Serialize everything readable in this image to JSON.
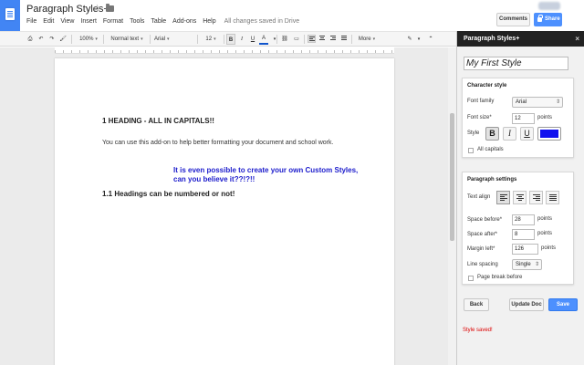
{
  "header": {
    "doc_title": "Paragraph Styles+",
    "menu": [
      "File",
      "Edit",
      "View",
      "Insert",
      "Format",
      "Tools",
      "Table",
      "Add-ons",
      "Help"
    ],
    "save_status": "All changes saved in Drive",
    "comments_label": "Comments",
    "share_label": "Share"
  },
  "toolbar": {
    "zoom": "100%",
    "style": "Normal text",
    "font": "Arial",
    "size": "12",
    "bold": "B",
    "italic": "I",
    "underline": "U",
    "text_color": "A",
    "more": "More"
  },
  "document": {
    "heading1": "1 HEADING - ALL IN CAPITALS!!",
    "paragraph": "You can use this add-on to help better formatting your document and school work.",
    "custom_line1": "It is even possible to create your own Custom Styles,",
    "custom_line2": "can you believe it??!?!!",
    "heading2": "1.1 Headings can be numbered or not!",
    "custom_color": "#1c1ccc"
  },
  "sidebar": {
    "title": "Paragraph Styles+",
    "close": "×",
    "style_name": "My First Style",
    "character": {
      "title": "Character style",
      "font_family_label": "Font family",
      "font_family_value": "Arial",
      "font_size_label": "Font size*",
      "font_size_value": "12",
      "points": "points",
      "style_label": "Style",
      "bold": "B",
      "italic": "I",
      "underline": "U",
      "color": "#1010ee",
      "all_caps_label": "All capitals"
    },
    "paragraph": {
      "title": "Paragraph settings",
      "text_align_label": "Text align",
      "space_before_label": "Space before*",
      "space_before_value": "28",
      "space_after_label": "Space after*",
      "space_after_value": "8",
      "margin_left_label": "Margin left*",
      "margin_left_value": "126",
      "points": "points",
      "line_spacing_label": "Line spacing",
      "line_spacing_value": "Single",
      "page_break_label": "Page break before"
    },
    "buttons": {
      "back": "Back",
      "update": "Update Doc",
      "save": "Save"
    },
    "status": "Style saved!"
  }
}
